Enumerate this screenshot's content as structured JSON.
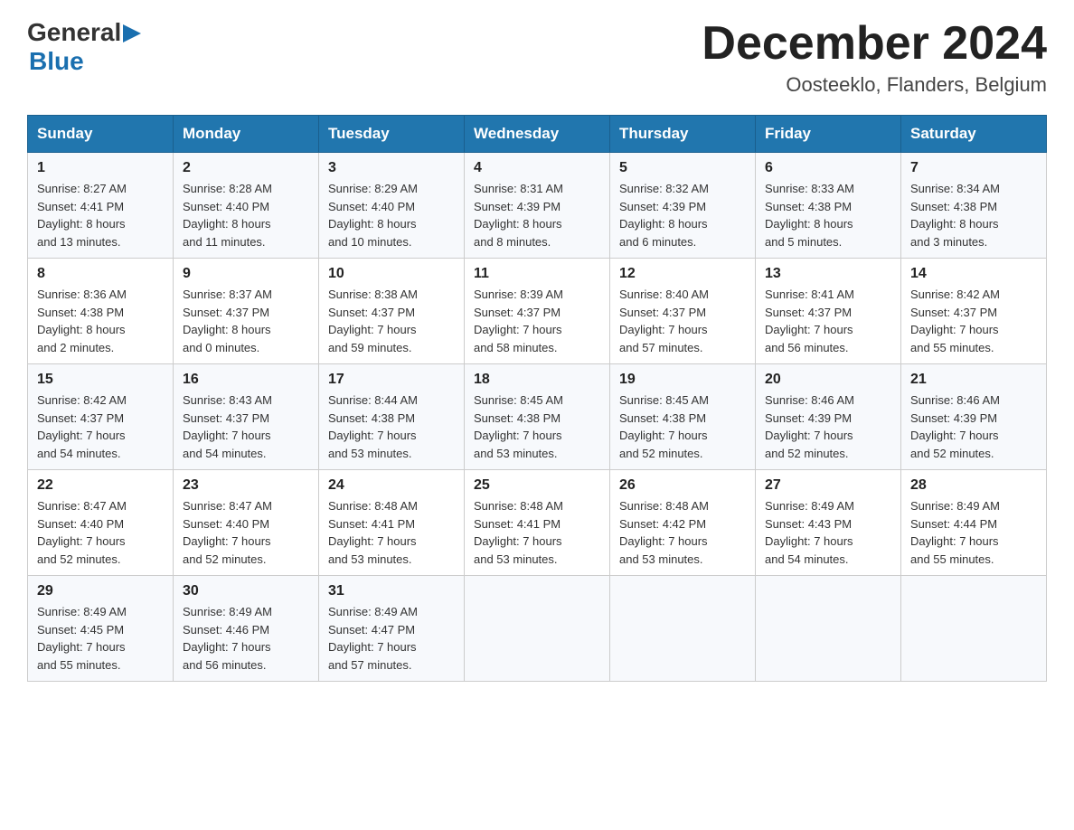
{
  "header": {
    "logo_general": "General",
    "logo_blue": "Blue",
    "month_title": "December 2024",
    "location": "Oosteeklo, Flanders, Belgium"
  },
  "weekdays": [
    "Sunday",
    "Monday",
    "Tuesday",
    "Wednesday",
    "Thursday",
    "Friday",
    "Saturday"
  ],
  "weeks": [
    [
      {
        "day": "1",
        "info": "Sunrise: 8:27 AM\nSunset: 4:41 PM\nDaylight: 8 hours\nand 13 minutes."
      },
      {
        "day": "2",
        "info": "Sunrise: 8:28 AM\nSunset: 4:40 PM\nDaylight: 8 hours\nand 11 minutes."
      },
      {
        "day": "3",
        "info": "Sunrise: 8:29 AM\nSunset: 4:40 PM\nDaylight: 8 hours\nand 10 minutes."
      },
      {
        "day": "4",
        "info": "Sunrise: 8:31 AM\nSunset: 4:39 PM\nDaylight: 8 hours\nand 8 minutes."
      },
      {
        "day": "5",
        "info": "Sunrise: 8:32 AM\nSunset: 4:39 PM\nDaylight: 8 hours\nand 6 minutes."
      },
      {
        "day": "6",
        "info": "Sunrise: 8:33 AM\nSunset: 4:38 PM\nDaylight: 8 hours\nand 5 minutes."
      },
      {
        "day": "7",
        "info": "Sunrise: 8:34 AM\nSunset: 4:38 PM\nDaylight: 8 hours\nand 3 minutes."
      }
    ],
    [
      {
        "day": "8",
        "info": "Sunrise: 8:36 AM\nSunset: 4:38 PM\nDaylight: 8 hours\nand 2 minutes."
      },
      {
        "day": "9",
        "info": "Sunrise: 8:37 AM\nSunset: 4:37 PM\nDaylight: 8 hours\nand 0 minutes."
      },
      {
        "day": "10",
        "info": "Sunrise: 8:38 AM\nSunset: 4:37 PM\nDaylight: 7 hours\nand 59 minutes."
      },
      {
        "day": "11",
        "info": "Sunrise: 8:39 AM\nSunset: 4:37 PM\nDaylight: 7 hours\nand 58 minutes."
      },
      {
        "day": "12",
        "info": "Sunrise: 8:40 AM\nSunset: 4:37 PM\nDaylight: 7 hours\nand 57 minutes."
      },
      {
        "day": "13",
        "info": "Sunrise: 8:41 AM\nSunset: 4:37 PM\nDaylight: 7 hours\nand 56 minutes."
      },
      {
        "day": "14",
        "info": "Sunrise: 8:42 AM\nSunset: 4:37 PM\nDaylight: 7 hours\nand 55 minutes."
      }
    ],
    [
      {
        "day": "15",
        "info": "Sunrise: 8:42 AM\nSunset: 4:37 PM\nDaylight: 7 hours\nand 54 minutes."
      },
      {
        "day": "16",
        "info": "Sunrise: 8:43 AM\nSunset: 4:37 PM\nDaylight: 7 hours\nand 54 minutes."
      },
      {
        "day": "17",
        "info": "Sunrise: 8:44 AM\nSunset: 4:38 PM\nDaylight: 7 hours\nand 53 minutes."
      },
      {
        "day": "18",
        "info": "Sunrise: 8:45 AM\nSunset: 4:38 PM\nDaylight: 7 hours\nand 53 minutes."
      },
      {
        "day": "19",
        "info": "Sunrise: 8:45 AM\nSunset: 4:38 PM\nDaylight: 7 hours\nand 52 minutes."
      },
      {
        "day": "20",
        "info": "Sunrise: 8:46 AM\nSunset: 4:39 PM\nDaylight: 7 hours\nand 52 minutes."
      },
      {
        "day": "21",
        "info": "Sunrise: 8:46 AM\nSunset: 4:39 PM\nDaylight: 7 hours\nand 52 minutes."
      }
    ],
    [
      {
        "day": "22",
        "info": "Sunrise: 8:47 AM\nSunset: 4:40 PM\nDaylight: 7 hours\nand 52 minutes."
      },
      {
        "day": "23",
        "info": "Sunrise: 8:47 AM\nSunset: 4:40 PM\nDaylight: 7 hours\nand 52 minutes."
      },
      {
        "day": "24",
        "info": "Sunrise: 8:48 AM\nSunset: 4:41 PM\nDaylight: 7 hours\nand 53 minutes."
      },
      {
        "day": "25",
        "info": "Sunrise: 8:48 AM\nSunset: 4:41 PM\nDaylight: 7 hours\nand 53 minutes."
      },
      {
        "day": "26",
        "info": "Sunrise: 8:48 AM\nSunset: 4:42 PM\nDaylight: 7 hours\nand 53 minutes."
      },
      {
        "day": "27",
        "info": "Sunrise: 8:49 AM\nSunset: 4:43 PM\nDaylight: 7 hours\nand 54 minutes."
      },
      {
        "day": "28",
        "info": "Sunrise: 8:49 AM\nSunset: 4:44 PM\nDaylight: 7 hours\nand 55 minutes."
      }
    ],
    [
      {
        "day": "29",
        "info": "Sunrise: 8:49 AM\nSunset: 4:45 PM\nDaylight: 7 hours\nand 55 minutes."
      },
      {
        "day": "30",
        "info": "Sunrise: 8:49 AM\nSunset: 4:46 PM\nDaylight: 7 hours\nand 56 minutes."
      },
      {
        "day": "31",
        "info": "Sunrise: 8:49 AM\nSunset: 4:47 PM\nDaylight: 7 hours\nand 57 minutes."
      },
      {
        "day": "",
        "info": ""
      },
      {
        "day": "",
        "info": ""
      },
      {
        "day": "",
        "info": ""
      },
      {
        "day": "",
        "info": ""
      }
    ]
  ]
}
